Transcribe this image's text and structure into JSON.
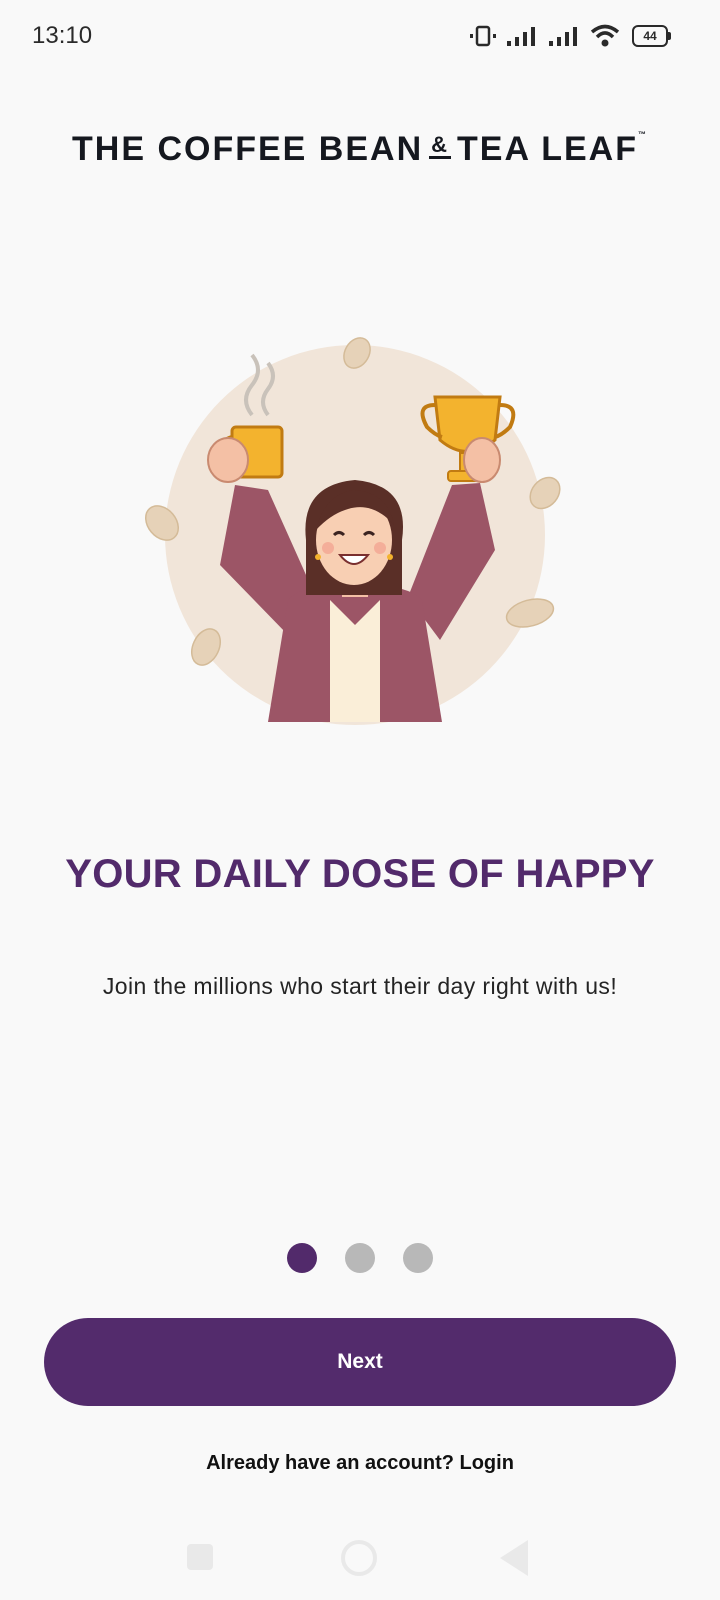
{
  "status_bar": {
    "time": "13:10",
    "battery_level": "44",
    "icons": [
      "vibrate-icon",
      "signal-icon",
      "signal-icon",
      "wifi-icon",
      "battery-icon"
    ]
  },
  "brand": {
    "part1": "THE COFFEE BEAN",
    "amp": "&",
    "part2": "TEA LEAF",
    "tm": "™"
  },
  "illustration": {
    "icon": "woman-with-coffee-and-trophy-illustration"
  },
  "onboarding": {
    "headline": "YOUR DAILY DOSE OF HAPPY",
    "subtext": "Join the millions who start their day right with us!",
    "page_count": 3,
    "current_page": 1
  },
  "actions": {
    "next_label": "Next",
    "login_prompt": "Already have an account? Login"
  },
  "colors": {
    "accent": "#532b6c",
    "inactive_dot": "#b8b8b8",
    "background": "#f9f9f9"
  },
  "nav_bar": {
    "icons": [
      "recents-icon",
      "home-icon",
      "back-icon"
    ]
  }
}
